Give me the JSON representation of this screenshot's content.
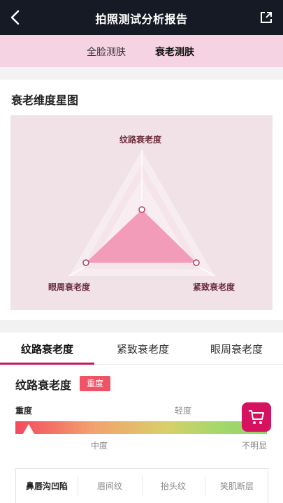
{
  "header": {
    "title": "拍照测试分析报告",
    "back_icon": "chevron-left-icon",
    "share_icon": "share-icon"
  },
  "subtabs": [
    "全脸测肤",
    "衰老测肤"
  ],
  "subtab_active": "衰老测肤",
  "radar": {
    "title": "衰老维度星图",
    "labels": {
      "top": "纹路衰老度",
      "left": "眼周衰老度",
      "right": "紧致衰老度"
    },
    "fill_color": "#f29cba",
    "background": "#f0e2e7"
  },
  "tabs": [
    "纹路衰老度",
    "紧致衰老度",
    "眼周衰老度"
  ],
  "tab_active": "纹路衰老度",
  "detail": {
    "metric_name": "纹路衰老度",
    "severity": "重度",
    "scale": {
      "top_left": "重度",
      "top_right": "轻度",
      "bottom_mid": "中度",
      "bottom_right": "不明显"
    },
    "accent_color": "#c8175b"
  },
  "sub_items": [
    "鼻唇沟凹陷",
    "眉间纹",
    "抬头纹",
    "笑肌断层"
  ],
  "cart_icon": "cart-icon"
}
